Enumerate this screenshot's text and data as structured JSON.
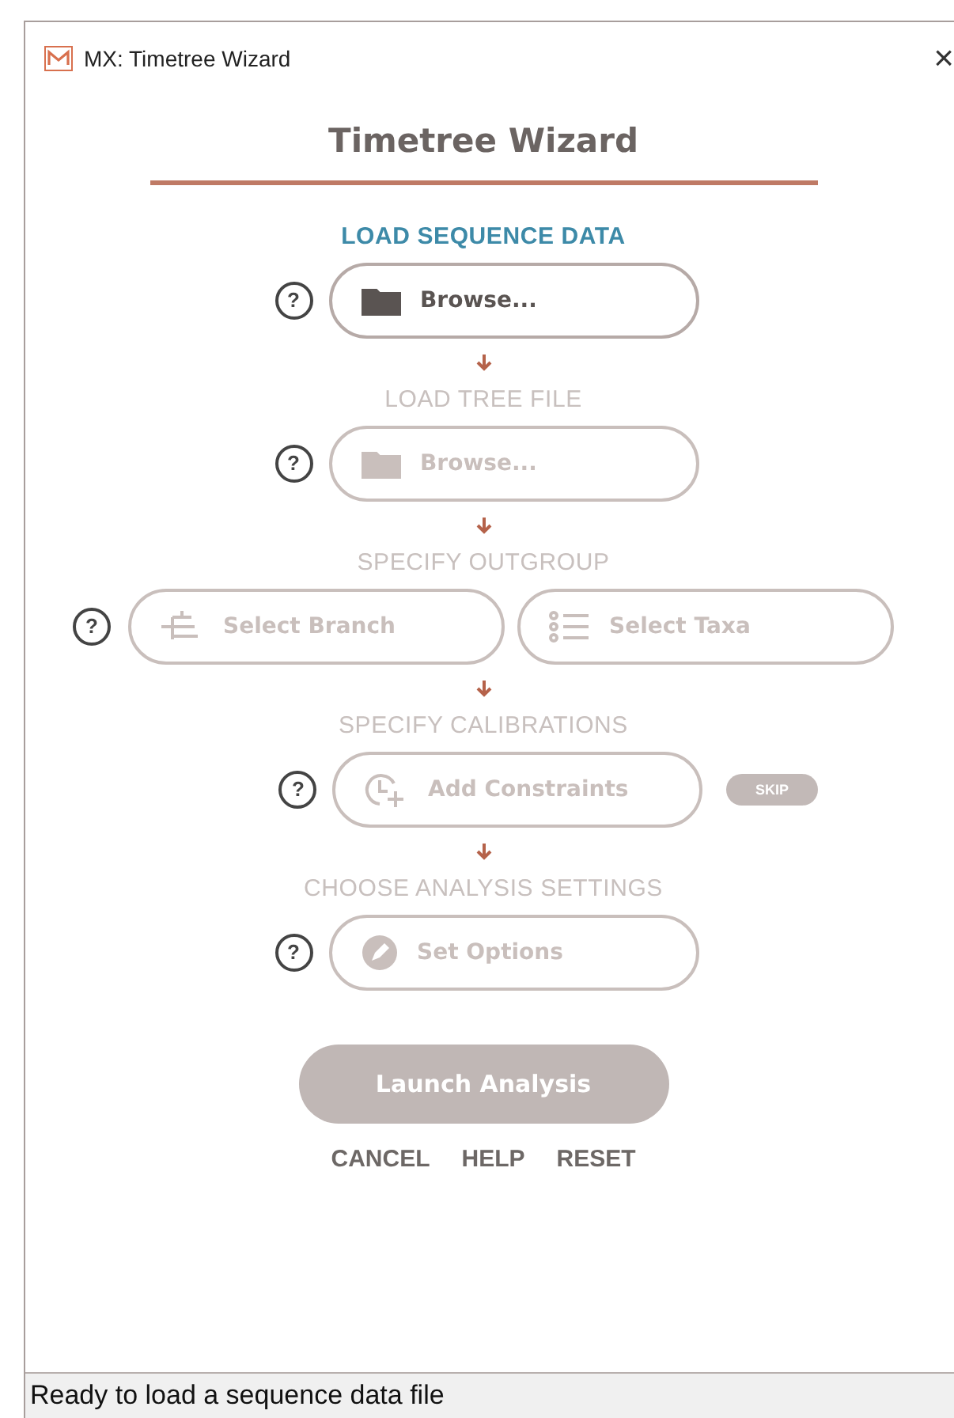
{
  "window": {
    "title": "MX: Timetree Wizard",
    "close": "×"
  },
  "heading": "Timetree Wizard",
  "steps": [
    {
      "label": "LOAD SEQUENCE DATA",
      "active": true,
      "buttons": [
        {
          "kind": "folder",
          "label": "Browse..."
        }
      ]
    },
    {
      "label": "LOAD TREE FILE",
      "active": false,
      "buttons": [
        {
          "kind": "folder",
          "label": "Browse..."
        }
      ]
    },
    {
      "label": "SPECIFY OUTGROUP",
      "active": false,
      "buttons": [
        {
          "kind": "branch",
          "label": "Select Branch"
        },
        {
          "kind": "list",
          "label": "Select Taxa"
        }
      ]
    },
    {
      "label": "SPECIFY CALIBRATIONS",
      "active": false,
      "buttons": [
        {
          "kind": "clock",
          "label": "Add Constraints"
        }
      ],
      "skip": "SKIP"
    },
    {
      "label": "CHOOSE ANALYSIS SETTINGS",
      "active": false,
      "buttons": [
        {
          "kind": "pencil",
          "label": "Set Options"
        }
      ]
    }
  ],
  "help_mark": "?",
  "launch": {
    "label": "Launch Analysis",
    "disabled": true
  },
  "links": [
    "CANCEL",
    "HELP",
    "RESET"
  ],
  "status_bar": "Ready to load a sequence data file"
}
